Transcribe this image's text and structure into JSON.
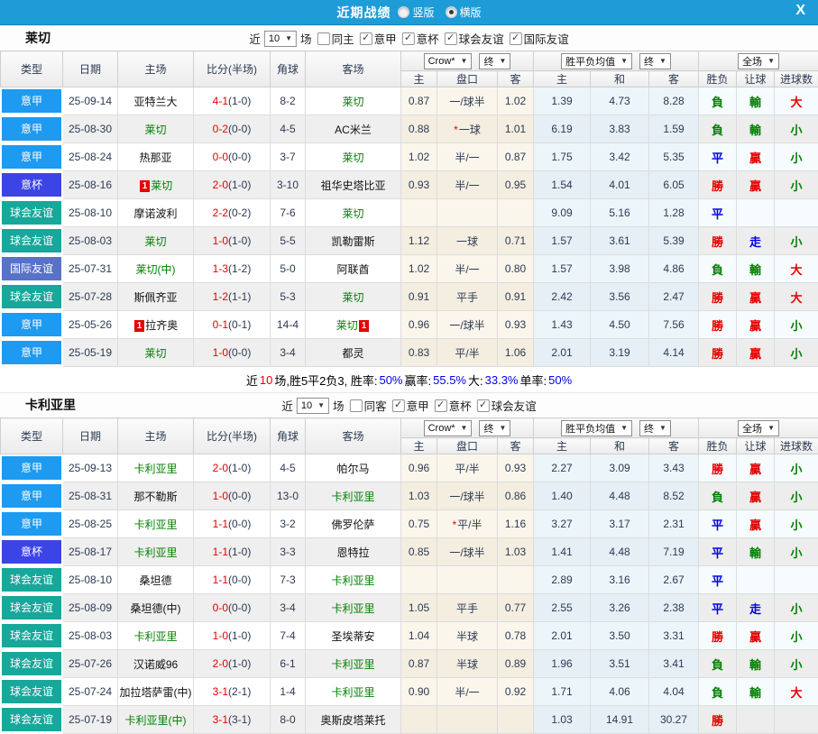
{
  "header": {
    "title": "近期战绩",
    "radio_vertical": "竖版",
    "radio_horizontal": "横版",
    "selected": "横版",
    "close": "X"
  },
  "colors": {
    "bar_blue": "#1e9cd7",
    "serie_a": "#1e9af0",
    "coppa": "#3d44e6",
    "club_friendly": "#17a79b",
    "intl_friendly": "#5872c8",
    "accent_red": "#e60000",
    "accent_green": "#008000",
    "accent_blue": "#0000e6"
  },
  "table_headers": {
    "type": "类型",
    "date": "日期",
    "home": "主场",
    "score": "比分(半场)",
    "corner": "角球",
    "away": "客场",
    "odds_home": "主",
    "handicap": "盘口",
    "odds_away": "客",
    "avg_home": "主",
    "avg_draw": "和",
    "avg_away": "客",
    "wdl": "胜负",
    "let_ball": "让球",
    "goals": "进球数",
    "crow_select": "Crow*",
    "final_select": "终",
    "avg_select": "胜平负均值",
    "scope_select": "全场"
  },
  "sections": [
    {
      "team": "莱切",
      "filters": {
        "near": "近",
        "count": "10",
        "unit": "场",
        "same_label": "同主",
        "same_checked": false,
        "leagues": [
          {
            "label": "意甲",
            "checked": true
          },
          {
            "label": "意杯",
            "checked": true
          },
          {
            "label": "球会友谊",
            "checked": true
          },
          {
            "label": "国际友谊",
            "checked": true
          }
        ]
      },
      "rows": [
        {
          "type": "意甲",
          "tc": "serie_a",
          "date": "25-09-14",
          "home": "亚特兰大",
          "hg": false,
          "hb": "",
          "score": "4-1",
          "half": "(1-0)",
          "corner": "8-2",
          "away": "莱切",
          "ag": true,
          "ab": "",
          "oh": "0.87",
          "hc": "一/球半",
          "hs": false,
          "oa": "1.02",
          "ah": "1.39",
          "ad": "4.73",
          "aa": "8.28",
          "r1": "負",
          "c1": "g",
          "r2": "輸",
          "c2": "g",
          "r3": "大",
          "c3": "r"
        },
        {
          "type": "意甲",
          "tc": "serie_a",
          "date": "25-08-30",
          "home": "莱切",
          "hg": true,
          "hb": "",
          "score": "0-2",
          "half": "(0-0)",
          "corner": "4-5",
          "away": "AC米兰",
          "ag": false,
          "ab": "",
          "oh": "0.88",
          "hc": "一球",
          "hs": true,
          "oa": "1.01",
          "ah": "6.19",
          "ad": "3.83",
          "aa": "1.59",
          "r1": "負",
          "c1": "g",
          "r2": "輸",
          "c2": "g",
          "r3": "小",
          "c3": "g"
        },
        {
          "type": "意甲",
          "tc": "serie_a",
          "date": "25-08-24",
          "home": "热那亚",
          "hg": false,
          "hb": "",
          "score": "0-0",
          "half": "(0-0)",
          "corner": "3-7",
          "away": "莱切",
          "ag": true,
          "ab": "",
          "oh": "1.02",
          "hc": "半/一",
          "hs": false,
          "oa": "0.87",
          "ah": "1.75",
          "ad": "3.42",
          "aa": "5.35",
          "r1": "平",
          "c1": "b",
          "r2": "贏",
          "c2": "r",
          "r3": "小",
          "c3": "g"
        },
        {
          "type": "意杯",
          "tc": "coppa",
          "date": "25-08-16",
          "home": "莱切",
          "hg": true,
          "hb": "before",
          "score": "2-0",
          "half": "(1-0)",
          "corner": "3-10",
          "away": "祖华史塔比亚",
          "ag": false,
          "ab": "",
          "oh": "0.93",
          "hc": "半/一",
          "hs": false,
          "oa": "0.95",
          "ah": "1.54",
          "ad": "4.01",
          "aa": "6.05",
          "r1": "勝",
          "c1": "r",
          "r2": "贏",
          "c2": "r",
          "r3": "小",
          "c3": "g"
        },
        {
          "type": "球会友谊",
          "tc": "club_friendly",
          "date": "25-08-10",
          "home": "摩诺波利",
          "hg": false,
          "hb": "",
          "score": "2-2",
          "half": "(0-2)",
          "corner": "7-6",
          "away": "莱切",
          "ag": true,
          "ab": "",
          "oh": "",
          "hc": "",
          "hs": false,
          "oa": "",
          "ah": "9.09",
          "ad": "5.16",
          "aa": "1.28",
          "r1": "平",
          "c1": "b",
          "r2": "",
          "c2": "",
          "r3": "",
          "c3": ""
        },
        {
          "type": "球会友谊",
          "tc": "club_friendly",
          "date": "25-08-03",
          "home": "莱切",
          "hg": true,
          "hb": "",
          "score": "1-0",
          "half": "(1-0)",
          "corner": "5-5",
          "away": "凯勒雷斯",
          "ag": false,
          "ab": "",
          "oh": "1.12",
          "hc": "一球",
          "hs": false,
          "oa": "0.71",
          "ah": "1.57",
          "ad": "3.61",
          "aa": "5.39",
          "r1": "勝",
          "c1": "r",
          "r2": "走",
          "c2": "b",
          "r3": "小",
          "c3": "g"
        },
        {
          "type": "国际友谊",
          "tc": "intl_friendly",
          "date": "25-07-31",
          "home": "莱切(中)",
          "hg": true,
          "hb": "",
          "score": "1-3",
          "half": "(1-2)",
          "corner": "5-0",
          "away": "阿联酋",
          "ag": false,
          "ab": "",
          "oh": "1.02",
          "hc": "半/一",
          "hs": false,
          "oa": "0.80",
          "ah": "1.57",
          "ad": "3.98",
          "aa": "4.86",
          "r1": "負",
          "c1": "g",
          "r2": "輸",
          "c2": "g",
          "r3": "大",
          "c3": "r"
        },
        {
          "type": "球会友谊",
          "tc": "club_friendly",
          "date": "25-07-28",
          "home": "斯佩齐亚",
          "hg": false,
          "hb": "",
          "score": "1-2",
          "half": "(1-1)",
          "corner": "5-3",
          "away": "莱切",
          "ag": true,
          "ab": "",
          "oh": "0.91",
          "hc": "平手",
          "hs": false,
          "oa": "0.91",
          "ah": "2.42",
          "ad": "3.56",
          "aa": "2.47",
          "r1": "勝",
          "c1": "r",
          "r2": "贏",
          "c2": "r",
          "r3": "大",
          "c3": "r"
        },
        {
          "type": "意甲",
          "tc": "serie_a",
          "date": "25-05-26",
          "home": "拉齐奥",
          "hg": false,
          "hb": "before",
          "score": "0-1",
          "half": "(0-1)",
          "corner": "14-4",
          "away": "莱切",
          "ag": true,
          "ab": "after",
          "oh": "0.96",
          "hc": "一/球半",
          "hs": false,
          "oa": "0.93",
          "ah": "1.43",
          "ad": "4.50",
          "aa": "7.56",
          "r1": "勝",
          "c1": "r",
          "r2": "贏",
          "c2": "r",
          "r3": "小",
          "c3": "g"
        },
        {
          "type": "意甲",
          "tc": "serie_a",
          "date": "25-05-19",
          "home": "莱切",
          "hg": true,
          "hb": "",
          "score": "1-0",
          "half": "(0-0)",
          "corner": "3-4",
          "away": "都灵",
          "ag": false,
          "ab": "",
          "oh": "0.83",
          "hc": "平/半",
          "hs": false,
          "oa": "1.06",
          "ah": "2.01",
          "ad": "3.19",
          "aa": "4.14",
          "r1": "勝",
          "c1": "r",
          "r2": "贏",
          "c2": "r",
          "r3": "小",
          "c3": "g"
        }
      ],
      "summary": [
        {
          "t": "近",
          "c": "k"
        },
        {
          "t": "10",
          "c": "r"
        },
        {
          "t": "场,胜5平2负3, 胜率:",
          "c": "k"
        },
        {
          "t": "50%",
          "c": "b"
        },
        {
          "t": " 赢率:",
          "c": "k"
        },
        {
          "t": "55.5%",
          "c": "b"
        },
        {
          "t": " 大:",
          "c": "k"
        },
        {
          "t": "33.3%",
          "c": "b"
        },
        {
          "t": " 单率:",
          "c": "k"
        },
        {
          "t": "50%",
          "c": "b"
        }
      ]
    },
    {
      "team": "卡利亚里",
      "filters": {
        "near": "近",
        "count": "10",
        "unit": "场",
        "same_label": "同客",
        "same_checked": false,
        "leagues": [
          {
            "label": "意甲",
            "checked": true
          },
          {
            "label": "意杯",
            "checked": true
          },
          {
            "label": "球会友谊",
            "checked": true
          }
        ]
      },
      "rows": [
        {
          "type": "意甲",
          "tc": "serie_a",
          "date": "25-09-13",
          "home": "卡利亚里",
          "hg": true,
          "hb": "",
          "score": "2-0",
          "half": "(1-0)",
          "corner": "4-5",
          "away": "帕尔马",
          "ag": false,
          "ab": "",
          "oh": "0.96",
          "hc": "平/半",
          "hs": false,
          "oa": "0.93",
          "ah": "2.27",
          "ad": "3.09",
          "aa": "3.43",
          "r1": "勝",
          "c1": "r",
          "r2": "贏",
          "c2": "r",
          "r3": "小",
          "c3": "g"
        },
        {
          "type": "意甲",
          "tc": "serie_a",
          "date": "25-08-31",
          "home": "那不勒斯",
          "hg": false,
          "hb": "",
          "score": "1-0",
          "half": "(0-0)",
          "corner": "13-0",
          "away": "卡利亚里",
          "ag": true,
          "ab": "",
          "oh": "1.03",
          "hc": "一/球半",
          "hs": false,
          "oa": "0.86",
          "ah": "1.40",
          "ad": "4.48",
          "aa": "8.52",
          "r1": "負",
          "c1": "g",
          "r2": "贏",
          "c2": "r",
          "r3": "小",
          "c3": "g"
        },
        {
          "type": "意甲",
          "tc": "serie_a",
          "date": "25-08-25",
          "home": "卡利亚里",
          "hg": true,
          "hb": "",
          "score": "1-1",
          "half": "(0-0)",
          "corner": "3-2",
          "away": "佛罗伦萨",
          "ag": false,
          "ab": "",
          "oh": "0.75",
          "hc": "平/半",
          "hs": true,
          "oa": "1.16",
          "ah": "3.27",
          "ad": "3.17",
          "aa": "2.31",
          "r1": "平",
          "c1": "b",
          "r2": "贏",
          "c2": "r",
          "r3": "小",
          "c3": "g"
        },
        {
          "type": "意杯",
          "tc": "coppa",
          "date": "25-08-17",
          "home": "卡利亚里",
          "hg": true,
          "hb": "",
          "score": "1-1",
          "half": "(1-0)",
          "corner": "3-3",
          "away": "恩特拉",
          "ag": false,
          "ab": "",
          "oh": "0.85",
          "hc": "一/球半",
          "hs": false,
          "oa": "1.03",
          "ah": "1.41",
          "ad": "4.48",
          "aa": "7.19",
          "r1": "平",
          "c1": "b",
          "r2": "輸",
          "c2": "g",
          "r3": "小",
          "c3": "g"
        },
        {
          "type": "球会友谊",
          "tc": "club_friendly",
          "date": "25-08-10",
          "home": "桑坦德",
          "hg": false,
          "hb": "",
          "score": "1-1",
          "half": "(0-0)",
          "corner": "7-3",
          "away": "卡利亚里",
          "ag": true,
          "ab": "",
          "oh": "",
          "hc": "",
          "hs": false,
          "oa": "",
          "ah": "2.89",
          "ad": "3.16",
          "aa": "2.67",
          "r1": "平",
          "c1": "b",
          "r2": "",
          "c2": "",
          "r3": "",
          "c3": ""
        },
        {
          "type": "球会友谊",
          "tc": "club_friendly",
          "date": "25-08-09",
          "home": "桑坦德(中)",
          "hg": false,
          "hb": "",
          "score": "0-0",
          "half": "(0-0)",
          "corner": "3-4",
          "away": "卡利亚里",
          "ag": true,
          "ab": "",
          "oh": "1.05",
          "hc": "平手",
          "hs": false,
          "oa": "0.77",
          "ah": "2.55",
          "ad": "3.26",
          "aa": "2.38",
          "r1": "平",
          "c1": "b",
          "r2": "走",
          "c2": "b",
          "r3": "小",
          "c3": "g"
        },
        {
          "type": "球会友谊",
          "tc": "club_friendly",
          "date": "25-08-03",
          "home": "卡利亚里",
          "hg": true,
          "hb": "",
          "score": "1-0",
          "half": "(1-0)",
          "corner": "7-4",
          "away": "圣埃蒂安",
          "ag": false,
          "ab": "",
          "oh": "1.04",
          "hc": "半球",
          "hs": false,
          "oa": "0.78",
          "ah": "2.01",
          "ad": "3.50",
          "aa": "3.31",
          "r1": "勝",
          "c1": "r",
          "r2": "贏",
          "c2": "r",
          "r3": "小",
          "c3": "g"
        },
        {
          "type": "球会友谊",
          "tc": "club_friendly",
          "date": "25-07-26",
          "home": "汉诺威96",
          "hg": false,
          "hb": "",
          "score": "2-0",
          "half": "(1-0)",
          "corner": "6-1",
          "away": "卡利亚里",
          "ag": true,
          "ab": "",
          "oh": "0.87",
          "hc": "半球",
          "hs": false,
          "oa": "0.89",
          "ah": "1.96",
          "ad": "3.51",
          "aa": "3.41",
          "r1": "負",
          "c1": "g",
          "r2": "輸",
          "c2": "g",
          "r3": "小",
          "c3": "g"
        },
        {
          "type": "球会友谊",
          "tc": "club_friendly",
          "date": "25-07-24",
          "home": "加拉塔萨雷(中)",
          "hg": false,
          "hb": "",
          "score": "3-1",
          "half": "(2-1)",
          "corner": "1-4",
          "away": "卡利亚里",
          "ag": true,
          "ab": "",
          "oh": "0.90",
          "hc": "半/一",
          "hs": false,
          "oa": "0.92",
          "ah": "1.71",
          "ad": "4.06",
          "aa": "4.04",
          "r1": "負",
          "c1": "g",
          "r2": "輸",
          "c2": "g",
          "r3": "大",
          "c3": "r"
        },
        {
          "type": "球会友谊",
          "tc": "club_friendly",
          "date": "25-07-19",
          "home": "卡利亚里(中)",
          "hg": true,
          "hb": "",
          "score": "3-1",
          "half": "(3-1)",
          "corner": "8-0",
          "away": "奥斯皮塔莱托",
          "ag": false,
          "ab": "",
          "oh": "",
          "hc": "",
          "hs": false,
          "oa": "",
          "ah": "1.03",
          "ad": "14.91",
          "aa": "30.27",
          "r1": "勝",
          "c1": "r",
          "r2": "",
          "c2": "",
          "r3": "",
          "c3": ""
        }
      ],
      "summary": []
    }
  ]
}
